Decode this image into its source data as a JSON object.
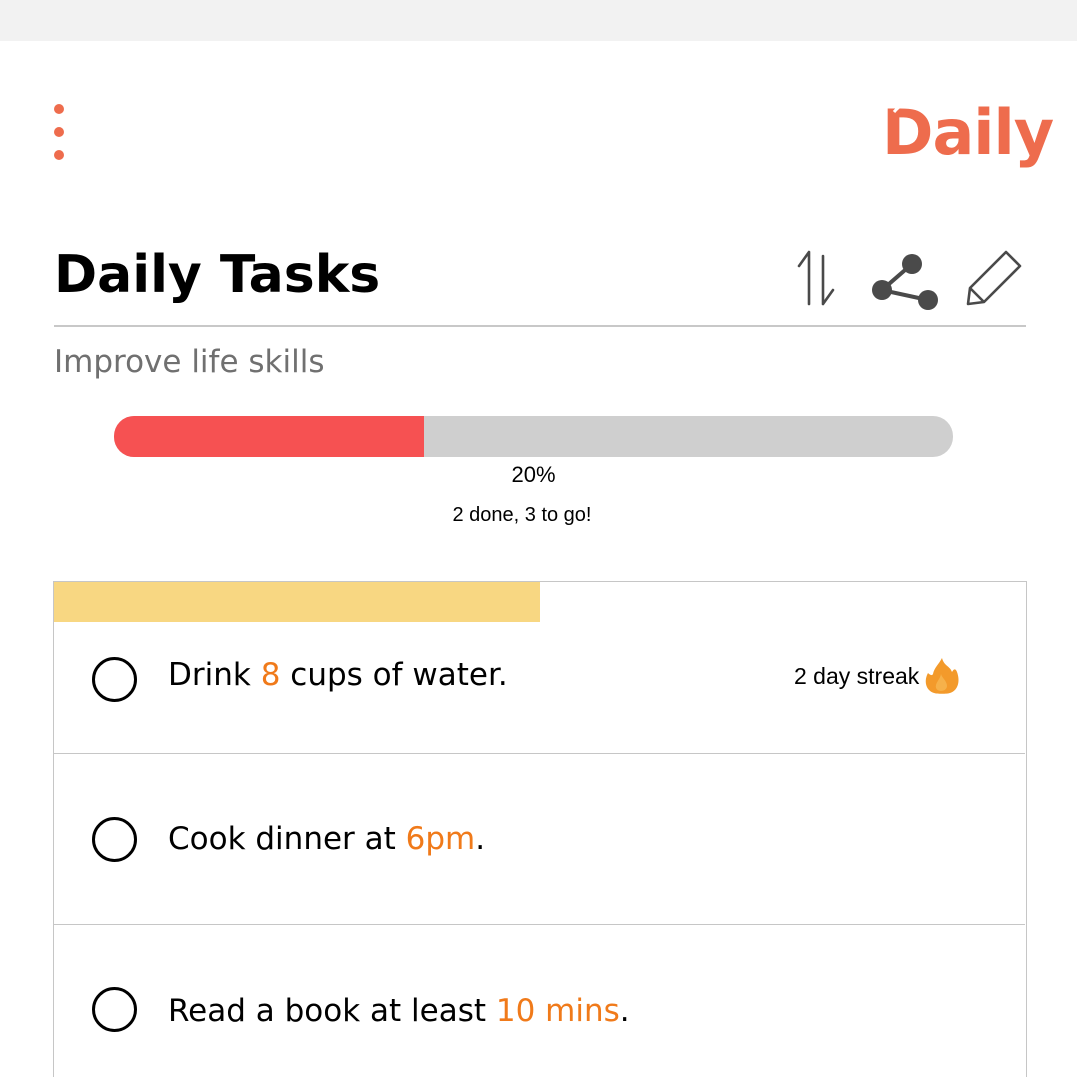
{
  "app": {
    "logo_text": "Daily"
  },
  "header": {
    "title": "Daily Tasks",
    "subtitle": "Improve life skills",
    "actions": [
      {
        "name": "sort",
        "icon": "sort-icon"
      },
      {
        "name": "share",
        "icon": "share-icon"
      },
      {
        "name": "edit",
        "icon": "pencil-icon"
      }
    ]
  },
  "progress": {
    "fraction": 0.37,
    "percent_label": "20%",
    "caption": "2 done, 3 to go!"
  },
  "tasks": [
    {
      "before": "Drink ",
      "highlight": "8",
      "after": " cups of water.",
      "streak": "2 day streak",
      "streak_icon": "flame-icon",
      "done": false
    },
    {
      "before": "Cook dinner at ",
      "highlight": "6pm",
      "after": ".",
      "done": false
    },
    {
      "before": "Read a book at least ",
      "highlight": "10 mins",
      "after": ".",
      "done": false
    }
  ],
  "colors": {
    "brand": "#ee6c4d",
    "progress_fill": "#f65152",
    "progress_track": "#cfcfcf",
    "highlight": "#f07a1a",
    "card_band": "#f8d782",
    "flame": "#f39a2b"
  }
}
